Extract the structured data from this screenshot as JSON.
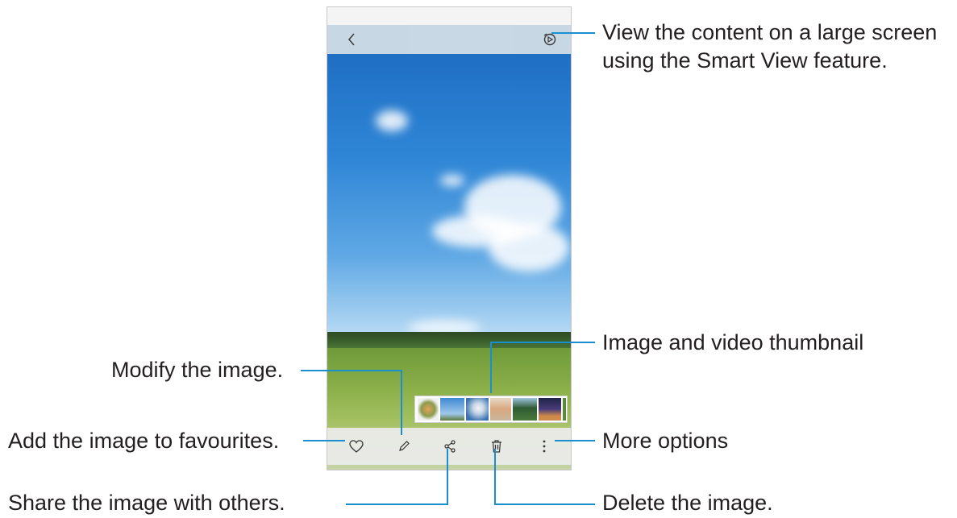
{
  "callouts": {
    "smart_view_line1": "View the content on a large screen",
    "smart_view_line2": "using the Smart View feature.",
    "thumbnail": "Image and video thumbnail",
    "modify": "Modify the image.",
    "favourites": "Add the image to favourites.",
    "more": "More options",
    "share": "Share the image with others.",
    "delete": "Delete the image."
  },
  "icons": {
    "back": "chevron-left-icon",
    "smart_view": "smart-view-icon",
    "favourite": "heart-icon",
    "edit": "pencil-icon",
    "share": "share-icon",
    "delete": "trash-icon",
    "more": "more-vertical-icon"
  },
  "colors": {
    "callout_line": "#1a8fd0",
    "text": "#231f20"
  }
}
